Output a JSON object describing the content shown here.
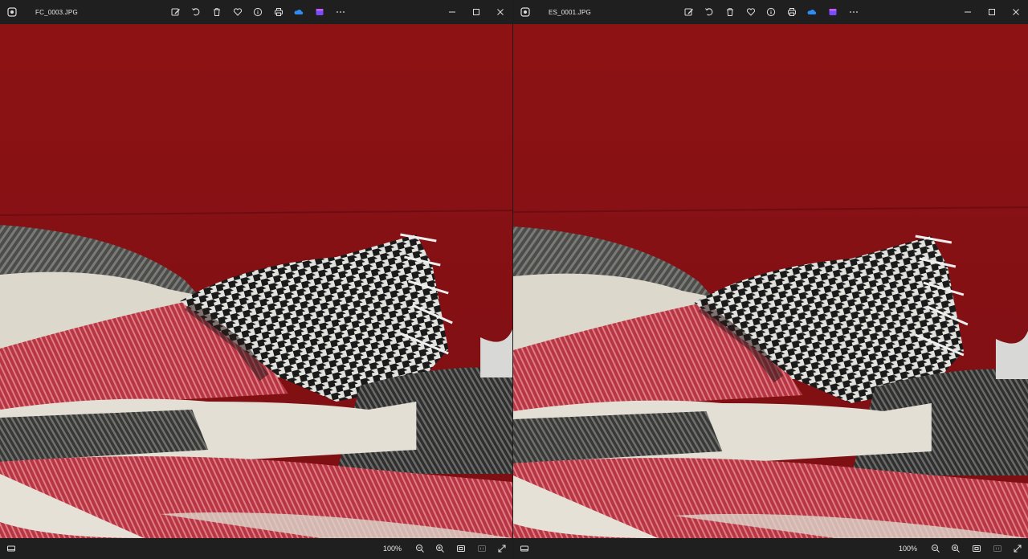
{
  "windows": [
    {
      "title": "FC_0003.JPG",
      "zoom_label": "100%",
      "toolbar": [
        "edit-image-icon",
        "rotate-icon",
        "delete-icon",
        "favorite-icon",
        "info-icon",
        "print-icon",
        "onedrive-icon",
        "clipchamp-icon",
        "more-icon"
      ]
    },
    {
      "title": "ES_0001.JPG",
      "zoom_label": "100%",
      "toolbar": [
        "edit-image-icon",
        "rotate-icon",
        "delete-icon",
        "favorite-icon",
        "info-icon",
        "print-icon",
        "onedrive-icon",
        "clipchamp-icon",
        "more-icon"
      ]
    }
  ],
  "colors": {
    "chrome_bg": "#1f1f1f",
    "red_backdrop": "#8a1114",
    "onedrive_blue": "#2f8cf0",
    "clipchamp_purple": "#7b4cf5",
    "fabric_red": "#b83a44",
    "fabric_cream": "#dfdbcf",
    "fabric_grey": "#5a5a58"
  }
}
